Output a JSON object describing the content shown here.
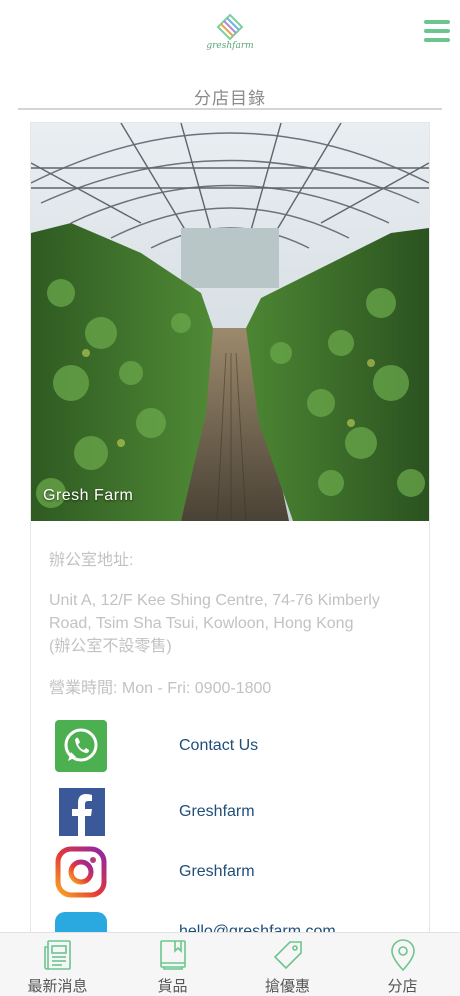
{
  "header": {
    "logo_icon": "gresh-logo-icon",
    "menu_icon": "hamburger-menu-icon",
    "accent_color": "#6cc58f"
  },
  "page": {
    "title": "分店目錄"
  },
  "store": {
    "photo_caption": "Gresh Farm",
    "office_label": "辦公室地址:",
    "address_line1": "Unit A, 12/F Kee Shing Centre, 74-76 Kimberly",
    "address_line2": "Road, Tsim Sha Tsui, Kowloon, Hong Kong",
    "address_note": "(辦公室不設零售)",
    "hours": "營業時間: Mon - Fri: 0900-1800"
  },
  "social": [
    {
      "icon": "whatsapp-icon",
      "label": "Contact Us"
    },
    {
      "icon": "facebook-icon",
      "label": "Greshfarm"
    },
    {
      "icon": "instagram-icon",
      "label": "Greshfarm"
    },
    {
      "icon": "email-icon",
      "label": "hello@greshfarm.com"
    }
  ],
  "tabs": [
    {
      "icon": "news-icon",
      "label": "最新消息"
    },
    {
      "icon": "book-icon",
      "label": "貨品"
    },
    {
      "icon": "tag-icon",
      "label": "搶優惠"
    },
    {
      "icon": "location-pin-icon",
      "label": "分店"
    }
  ]
}
